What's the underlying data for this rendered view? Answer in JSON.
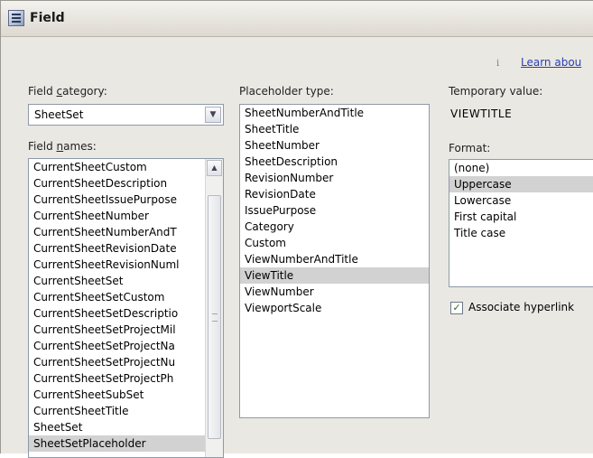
{
  "window": {
    "title": "Field"
  },
  "help": {
    "link": "Learn abou"
  },
  "field_category": {
    "label_pre": "Field ",
    "label_key": "c",
    "label_post": "ategory:",
    "selected": "SheetSet"
  },
  "field_names": {
    "label_pre": "Field ",
    "label_key": "n",
    "label_post": "ames:",
    "items": [
      "CurrentSheetCustom",
      "CurrentSheetDescription",
      "CurrentSheetIssuePurpose",
      "CurrentSheetNumber",
      "CurrentSheetNumberAndT",
      "CurrentSheetRevisionDate",
      "CurrentSheetRevisionNuml",
      "CurrentSheetSet",
      "CurrentSheetSetCustom",
      "CurrentSheetSetDescriptio",
      "CurrentSheetSetProjectMil",
      "CurrentSheetSetProjectNa",
      "CurrentSheetSetProjectNu",
      "CurrentSheetSetProjectPh",
      "CurrentSheetSubSet",
      "CurrentSheetTitle",
      "SheetSet",
      "SheetSetPlaceholder"
    ],
    "selected_index": 17
  },
  "placeholder_type": {
    "label": "Placeholder type:",
    "items": [
      "SheetNumberAndTitle",
      "SheetTitle",
      "SheetNumber",
      "SheetDescription",
      "RevisionNumber",
      "RevisionDate",
      "IssuePurpose",
      "Category",
      "Custom",
      "ViewNumberAndTitle",
      "ViewTitle",
      "ViewNumber",
      "ViewportScale"
    ],
    "selected_index": 10
  },
  "temporary_value": {
    "label": "Temporary value:",
    "value": "VIEWTITLE"
  },
  "format": {
    "label": "Format:",
    "items": [
      "(none)",
      "Uppercase",
      "Lowercase",
      "First capital",
      "Title case"
    ],
    "selected_index": 1
  },
  "associate_hyperlink": {
    "label": "Associate hyperlink",
    "checked": true
  }
}
